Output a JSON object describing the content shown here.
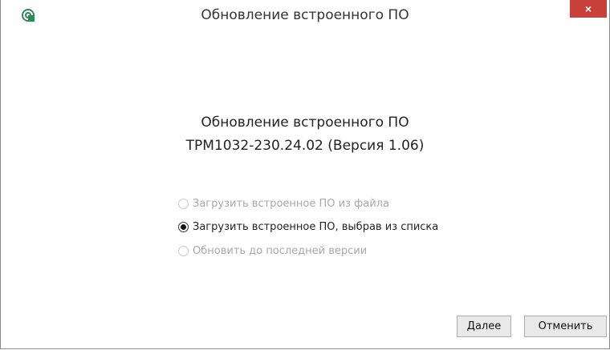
{
  "window": {
    "title": "Обновление встроенного ПО",
    "close_glyph": "×",
    "icon": "owen-app-icon",
    "accent_close_color": "#c7403a"
  },
  "main": {
    "heading_line1": "Обновление встроенного ПО",
    "heading_line2": "ТРМ1032-230.24.02 (Версия 1.06)",
    "options": [
      {
        "label": "Загрузить встроенное ПО из файла",
        "selected": false,
        "enabled": false
      },
      {
        "label": "Загрузить встроенное ПО, выбрав из списка",
        "selected": true,
        "enabled": true
      },
      {
        "label": "Обновить до последней версии",
        "selected": false,
        "enabled": false
      }
    ]
  },
  "footer": {
    "next_label": "Далее",
    "cancel_label": "Отменить"
  }
}
